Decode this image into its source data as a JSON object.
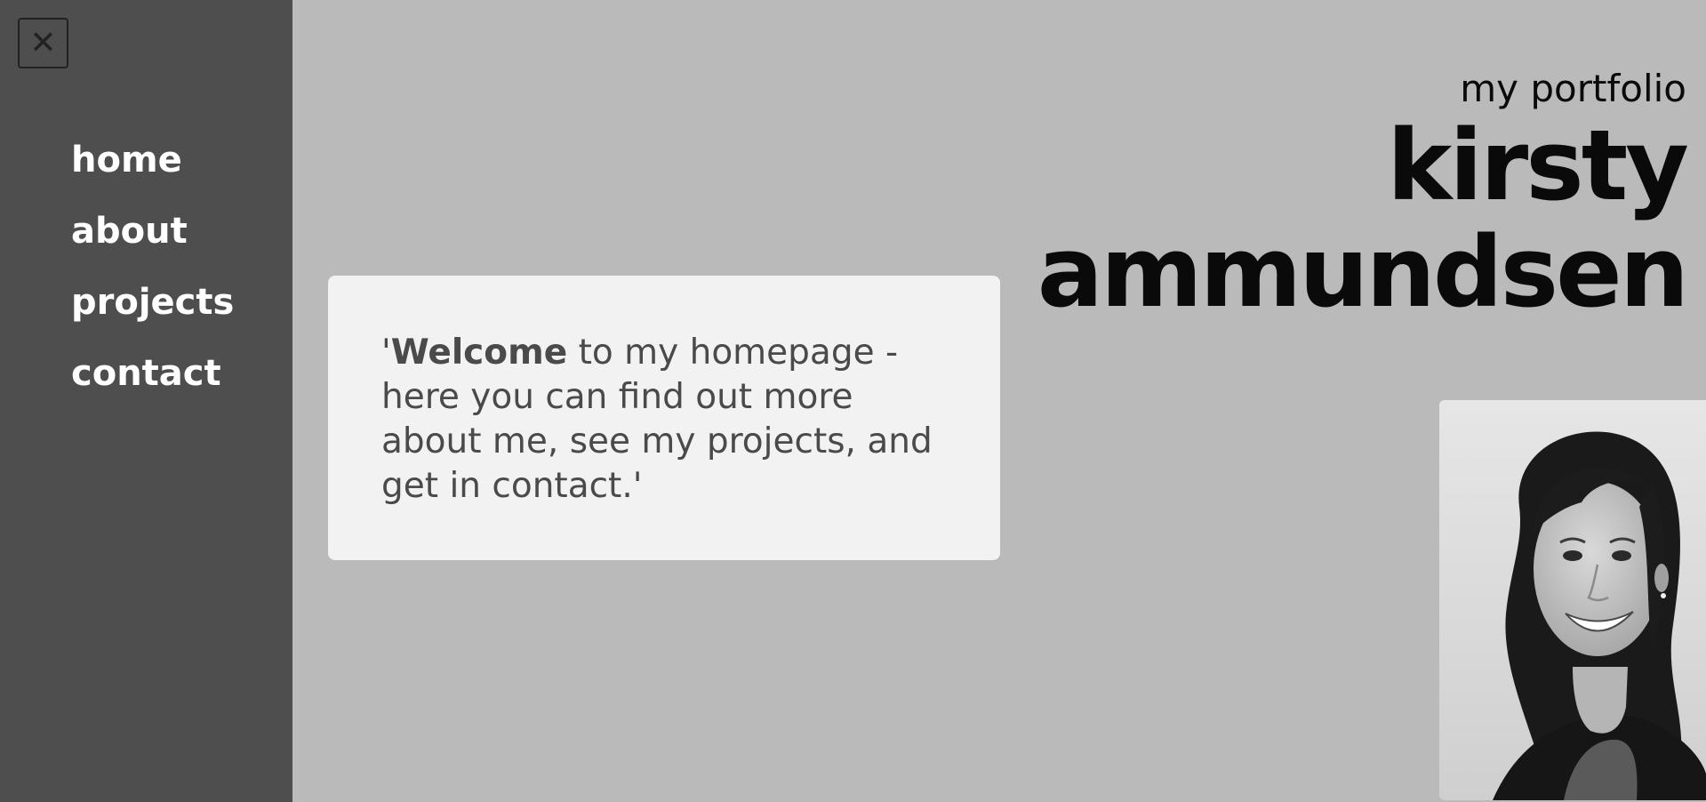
{
  "sidebar": {
    "close_glyph": "✕",
    "items": [
      {
        "label": "home"
      },
      {
        "label": "about"
      },
      {
        "label": "projects"
      },
      {
        "label": "contact"
      }
    ]
  },
  "header": {
    "subtitle": "my portfolio",
    "name_line1": "kirsty",
    "name_line2": "ammundsen"
  },
  "welcome": {
    "quote_open": "'",
    "bold_word": "Welcome",
    "rest": " to my homepage - here you can find out more about me, see my projects, and get in contact.'"
  },
  "colors": {
    "page_bg": "#bababa",
    "sidebar_bg": "#4e4e4e",
    "card_bg": "#f2f2f2",
    "card_text": "#4a4a4a",
    "nav_text": "#ffffff"
  },
  "icons": {
    "close": "close-icon"
  }
}
